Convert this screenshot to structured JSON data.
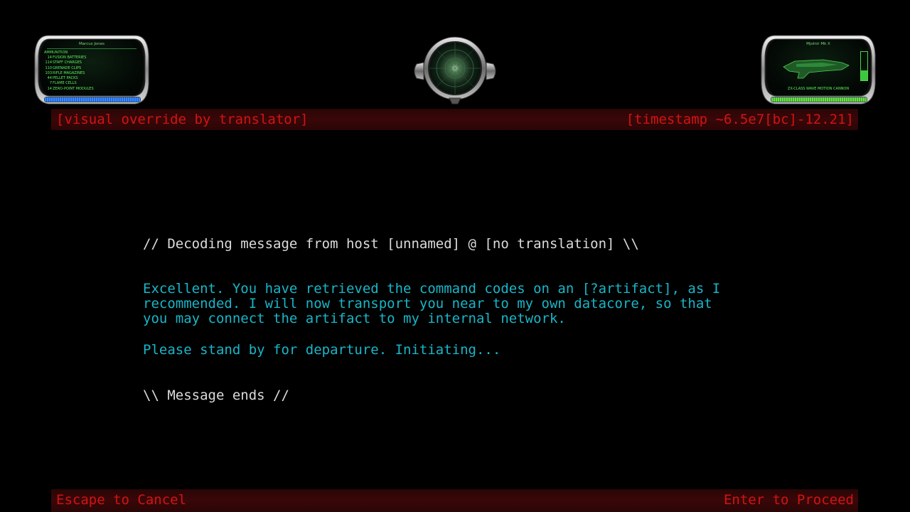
{
  "hud_left": {
    "owner": "Marcus Jones",
    "heading": "AMMUNITION",
    "items": [
      {
        "count": "14",
        "name": "FUSION BATTERIES"
      },
      {
        "count": "114",
        "name": "STAFF CHARGES"
      },
      {
        "count": "110",
        "name": "GRENADE CLIPS"
      },
      {
        "count": "103",
        "name": "RIFLE MAGAZINES"
      },
      {
        "count": "44",
        "name": "PELLET PACKS"
      },
      {
        "count": "7",
        "name": "FLAME CELLS"
      },
      {
        "count": "14",
        "name": "ZERO-POINT MODULES"
      }
    ],
    "bar_level": 1.0,
    "bar_color": "#3a8cff"
  },
  "hud_right": {
    "weapon_name": "Mjolnir Mk X",
    "weapon_desc": "ZX-CLASS WAVE MOTION CANNON",
    "gauge_level": 0.35,
    "bar_level": 1.0,
    "bar_color": "#6ce04a",
    "weapon_icon": "cannon-icon"
  },
  "radar": {
    "icon": "motion-sensor-icon"
  },
  "top_bar": {
    "left": "[visual override by translator]",
    "right": "[timestamp ~6.5e7[bc]-12.21]"
  },
  "message": {
    "header": "// Decoding message from host [unnamed] @ [no translation] \\\\",
    "paragraph1": "Excellent. You have retrieved the command codes on an [?artifact], as I\nrecommended. I will now transport you near to my own datacore, so that\nyou may connect the artifact to my internal network.",
    "paragraph2": "Please stand by for departure. Initiating...",
    "footer": "\\\\ Message ends //"
  },
  "bottom_bar": {
    "cancel": "Escape to Cancel",
    "proceed": "Enter to Proceed"
  },
  "colors": {
    "accent_red": "#d11414",
    "message_cyan": "#19b6c8",
    "hud_green": "#5cf05c"
  }
}
